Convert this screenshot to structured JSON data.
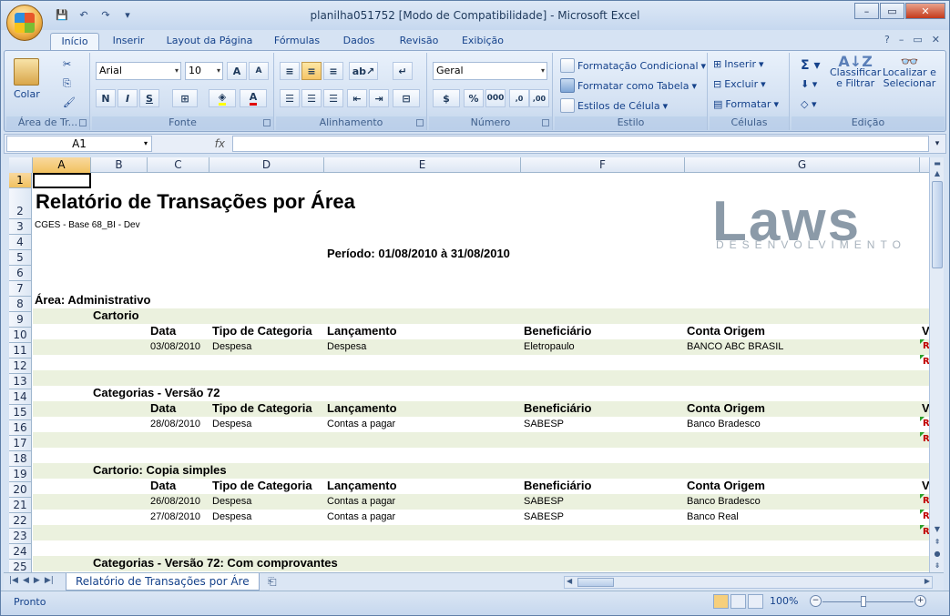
{
  "window": {
    "title": "planilha051752  [Modo de Compatibilidade] - Microsoft Excel",
    "min": "–",
    "max": "▭",
    "close": "✕"
  },
  "qat": {
    "save": "💾",
    "undo": "↶",
    "redo": "↷",
    "more": "▾"
  },
  "tabs": [
    "Início",
    "Inserir",
    "Layout da Página",
    "Fórmulas",
    "Dados",
    "Revisão",
    "Exibição"
  ],
  "ribbon": {
    "clipboard": {
      "paste": "Colar",
      "label": "Área de Tr..."
    },
    "font": {
      "name": "Arial",
      "size": "10",
      "bold": "N",
      "italic": "I",
      "underline": "S",
      "label": "Fonte"
    },
    "alignment": {
      "label": "Alinhamento"
    },
    "number": {
      "format": "Geral",
      "percent": "%",
      "thousands": "000",
      "label": "Número"
    },
    "style": {
      "conditional": "Formatação Condicional",
      "table": "Formatar como Tabela",
      "cell": "Estilos de Célula",
      "label": "Estilo"
    },
    "cells": {
      "insert": "Inserir",
      "delete": "Excluir",
      "format": "Formatar",
      "label": "Células"
    },
    "editing": {
      "sort1": "Classificar",
      "sort2": "e Filtrar",
      "find1": "Localizar e",
      "find2": "Selecionar",
      "label": "Edição"
    }
  },
  "formula_bar": {
    "name_box": "A1",
    "fx": "fx",
    "value": ""
  },
  "columns": [
    "A",
    "B",
    "C",
    "D",
    "E",
    "F",
    "G"
  ],
  "rows": [
    "1",
    "2",
    "3",
    "4",
    "5",
    "6",
    "7",
    "8",
    "9",
    "10",
    "11",
    "12",
    "13",
    "14",
    "15",
    "16",
    "17",
    "18",
    "19",
    "20",
    "21",
    "22",
    "23",
    "24",
    "25"
  ],
  "sheet": {
    "title": "Relatório de Transações por Área",
    "subtitle": "CGES - Base 68_BI - Dev",
    "period": "Período: 01/08/2010 à 31/08/2010",
    "logo_big": "Laws",
    "logo_sub": "DESENVOLVIMENTO",
    "area": "Área: Administrativo",
    "headers": {
      "date": "Data",
      "type": "Tipo de Categoria",
      "entry": "Lançamento",
      "beneficiary": "Beneficiário",
      "account": "Conta Origem",
      "value": "V"
    },
    "sections": [
      {
        "name": "Cartorio",
        "rows": [
          {
            "date": "03/08/2010",
            "type": "Despesa",
            "entry": "Despesa",
            "beneficiary": "Eletropaulo",
            "account": "BANCO ABC BRASIL"
          }
        ]
      },
      {
        "name": "Categorias - Versão 72",
        "rows": [
          {
            "date": "28/08/2010",
            "type": "Despesa",
            "entry": "Contas a pagar",
            "beneficiary": "SABESP",
            "account": "Banco Bradesco"
          }
        ]
      },
      {
        "name": "Cartorio: Copia simples",
        "rows": [
          {
            "date": "26/08/2010",
            "type": "Despesa",
            "entry": "Contas a pagar",
            "beneficiary": "SABESP",
            "account": "Banco Bradesco"
          },
          {
            "date": "27/08/2010",
            "type": "Despesa",
            "entry": "Contas a pagar",
            "beneficiary": "SABESP",
            "account": "Banco Real"
          }
        ]
      },
      {
        "name": "Categorias - Versão 72: Com comprovantes",
        "rows": []
      }
    ],
    "value_mark": "R"
  },
  "sheet_tab": "Relatório de Transações por Áre",
  "status": {
    "ready": "Pronto",
    "zoom": "100%"
  }
}
